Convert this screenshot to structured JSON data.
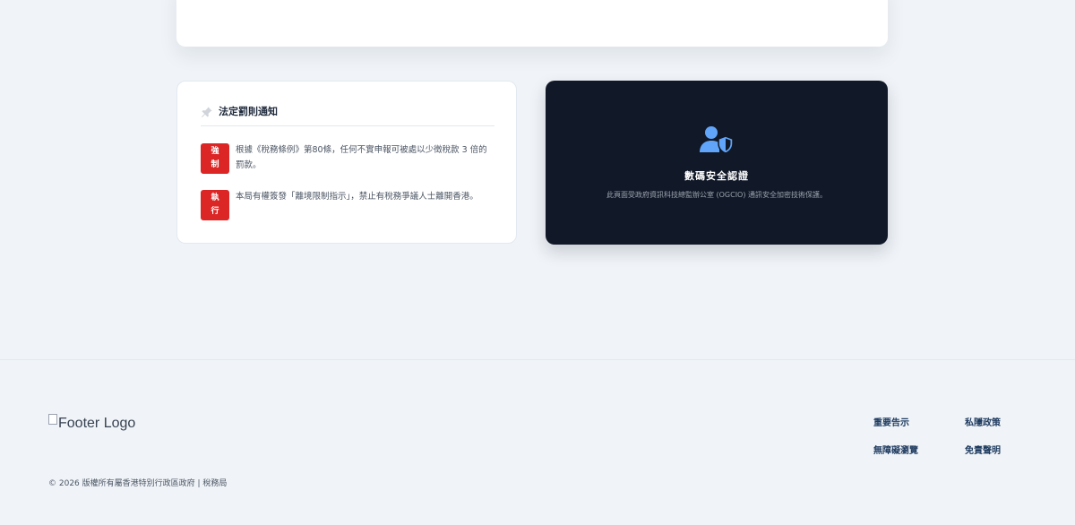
{
  "notice": {
    "title": "法定罰則通知",
    "items": [
      {
        "badge_top": "強",
        "badge_bottom": "制",
        "text": "根據《稅務條例》第80條，任何不實申報可被處以少徵稅款 3 倍的罰款。"
      },
      {
        "badge_top": "執",
        "badge_bottom": "行",
        "text": "本局有權簽發「離境限制指示」，禁止有稅務爭議人士離開香港。"
      }
    ]
  },
  "security": {
    "title": "數碼安全認證",
    "description": "此頁面受政府資訊科技總監辦公室 (OGCIO) 通訊安全加密技術保護。",
    "icon": "user-shield-icon",
    "icon_color": "#60a5fa"
  },
  "footer": {
    "logo_alt": "Footer Logo",
    "copyright": "© 2026 版權所有屬香港特別行政區政府 | 稅務局",
    "links": {
      "important_notices": "重要告示",
      "privacy_policy": "私隱政策",
      "accessibility": "無障礙瀏覽",
      "disclaimer": "免責聲明"
    }
  },
  "colors": {
    "badge": "#dc2626",
    "security_card_bg": "#111827",
    "page_bg": "#f0f4f8"
  }
}
